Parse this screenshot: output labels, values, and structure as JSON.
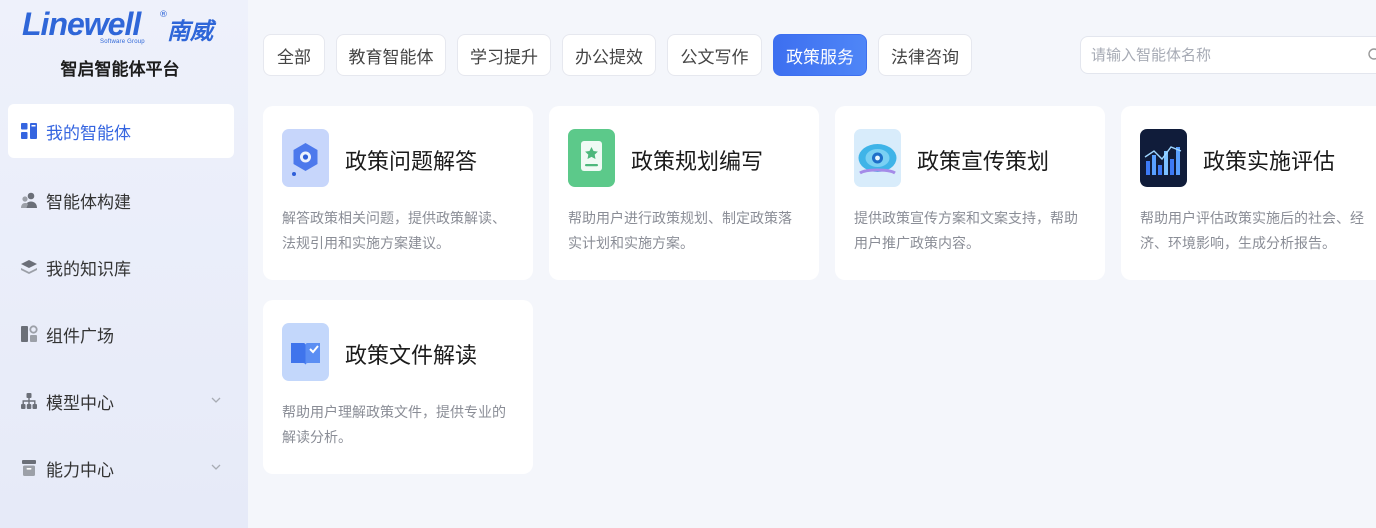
{
  "brand": {
    "logo_text": "Linewell",
    "logo_cn": "南威",
    "logo_reg": "®",
    "logo_sub": "Software Group",
    "platform_title": "智启智能体平台",
    "color": "#2f66d8"
  },
  "sidebar": {
    "items": [
      {
        "label": "我的智能体",
        "icon": "grid-icon",
        "active": true
      },
      {
        "label": "智能体构建",
        "icon": "users-icon"
      },
      {
        "label": "我的知识库",
        "icon": "layers-icon"
      },
      {
        "label": "组件广场",
        "icon": "components-icon"
      },
      {
        "label": "模型中心",
        "icon": "hierarchy-icon",
        "expandable": true
      },
      {
        "label": "能力中心",
        "icon": "box-icon",
        "expandable": true
      }
    ]
  },
  "tabs": [
    {
      "label": "全部"
    },
    {
      "label": "教育智能体"
    },
    {
      "label": "学习提升"
    },
    {
      "label": "办公提效"
    },
    {
      "label": "公文写作"
    },
    {
      "label": "政策服务",
      "active": true
    },
    {
      "label": "法律咨询"
    }
  ],
  "search": {
    "placeholder": "请输入智能体名称",
    "icon": "search-icon"
  },
  "cards": [
    {
      "title": "政策问题解答",
      "desc": "解答政策相关问题，提供政策解读、法规引用和实施方案建议。",
      "icon": "policy-qa-icon"
    },
    {
      "title": "政策规划编写",
      "desc": "帮助用户进行政策规划、制定政策落实计划和实施方案。",
      "icon": "policy-plan-icon"
    },
    {
      "title": "政策宣传策划",
      "desc": "提供政策宣传方案和文案支持，帮助用户推广政策内容。",
      "icon": "policy-promo-icon"
    },
    {
      "title": "政策实施评估",
      "desc": "帮助用户评估政策实施后的社会、经济、环境影响，生成分析报告。",
      "icon": "policy-eval-icon"
    },
    {
      "title": "政策文件解读",
      "desc": "帮助用户理解政策文件，提供专业的解读分析。",
      "icon": "policy-doc-icon"
    }
  ],
  "colors": {
    "accent": "#3d6ff0",
    "active_text": "#3565e0",
    "background": "#f4f6fb"
  }
}
